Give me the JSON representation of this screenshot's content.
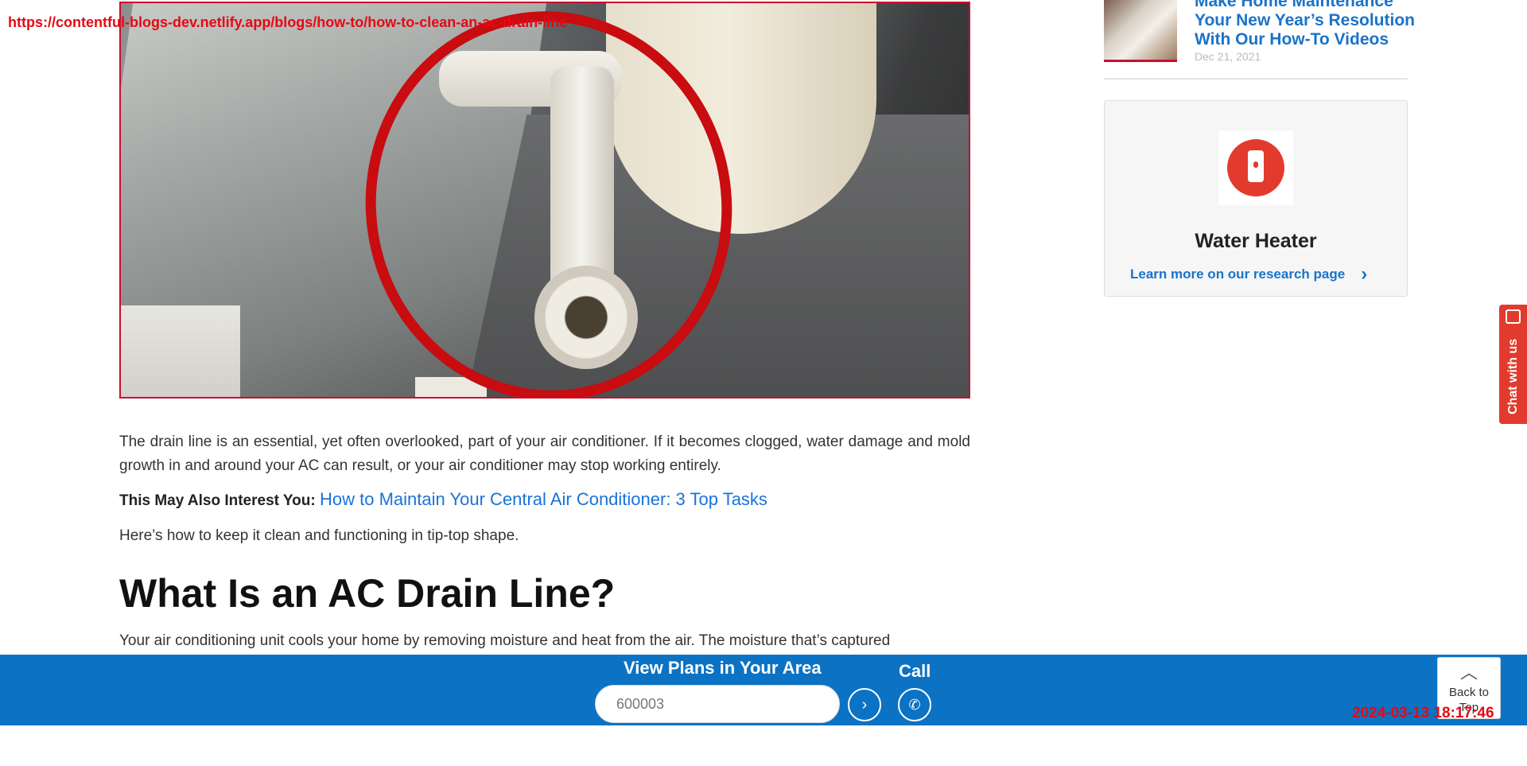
{
  "overlay": {
    "url": "https://contentful-blogs-dev.netlify.app/blogs/how-to/how-to-clean-an-ac-drain-line",
    "timestamp": "2024-03-13 18:17:46"
  },
  "article": {
    "intro": "The drain line is an essential, yet often overlooked, part of your air conditioner. If it becomes clogged, water damage and mold growth in and around your AC can result, or your air conditioner may stop working entirely.",
    "interest_label": "This May Also Interest You:",
    "interest_link": "How to Maintain Your Central Air Conditioner: 3 Top Tasks",
    "keep_clean": "Here’s how to keep it clean and functioning in tip-top shape.",
    "heading": "What Is an AC Drain Line?",
    "next_paragraph": "Your air conditioning unit cools your home by removing moisture and heat from the air. The moisture that’s captured"
  },
  "sidebar": {
    "related_title": "Make Home Maintenance Your New Year’s Resolution With Our How-To Videos",
    "related_date": "Dec 21, 2021",
    "card": {
      "title": "Water Heater",
      "link": "Learn more on our research page",
      "icon": "water-heater-icon"
    }
  },
  "chat": {
    "label": "Chat with us"
  },
  "bottom_bar": {
    "title": "View Plans in Your Area",
    "zip_value": "600003",
    "call_label": "Call"
  },
  "back_to_top": {
    "label": "Back to Top"
  },
  "colors": {
    "brand_blue": "#0b72c4",
    "link_blue": "#1a73c9",
    "accent_red": "#e23b2e",
    "overlay_red": "#e50914"
  }
}
